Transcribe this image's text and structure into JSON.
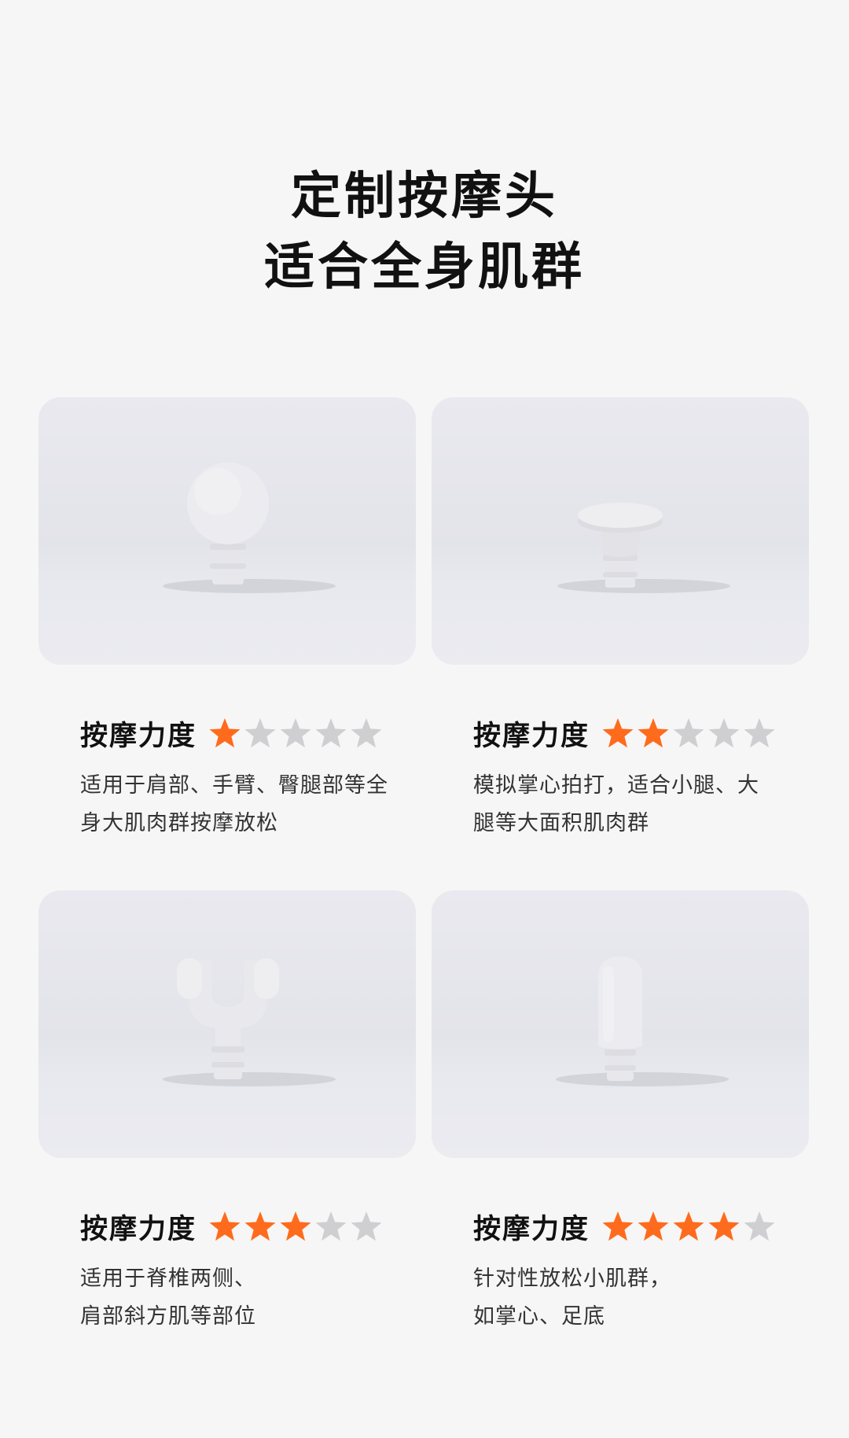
{
  "header": {
    "line1": "定制按摩头",
    "line2": "适合全身肌群"
  },
  "colors": {
    "star_filled": "#ff6b1c",
    "star_empty": "#cfcfd2",
    "background": "#f6f6f6"
  },
  "cards": [
    {
      "head_shape": "ball-head",
      "rating_label": "按摩力度",
      "rating": 1,
      "rating_max": 5,
      "desc_line1": "适用于肩部、手臂、臀腿部等全",
      "desc_line2": "身大肌肉群按摩放松"
    },
    {
      "head_shape": "flat-head",
      "rating_label": "按摩力度",
      "rating": 2,
      "rating_max": 5,
      "desc_line1": "模拟掌心拍打，适合小腿、大",
      "desc_line2": "腿等大面积肌肉群"
    },
    {
      "head_shape": "fork-head",
      "rating_label": "按摩力度",
      "rating": 3,
      "rating_max": 5,
      "desc_line1": "适用于脊椎两侧、",
      "desc_line2": "肩部斜方肌等部位"
    },
    {
      "head_shape": "bullet-head",
      "rating_label": "按摩力度",
      "rating": 4,
      "rating_max": 5,
      "desc_line1": "针对性放松小肌群，",
      "desc_line2": "如掌心、足底"
    }
  ]
}
